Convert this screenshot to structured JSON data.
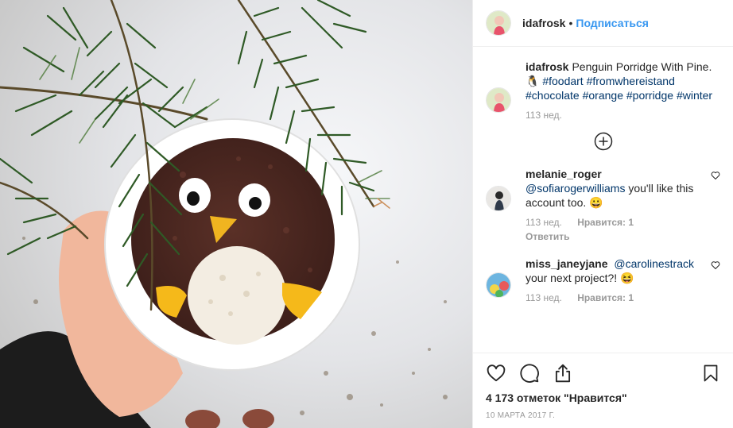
{
  "post": {
    "username": "idafrosk",
    "separator": "•",
    "follow_label": "Подписаться"
  },
  "caption": {
    "username": "idafrosk",
    "text": "Penguin Porridge With Pine. 🐧",
    "hashtags": [
      "#foodart",
      "#fromwhereistand",
      "#chocolate",
      "#orange",
      "#porridge",
      "#winter"
    ],
    "time": "113 нед."
  },
  "comments": [
    {
      "username": "melanie_roger",
      "mention": "@sofiarogerwilliams",
      "text": "you'll like this account too. 😀",
      "time": "113 нед.",
      "likes": "Нравится: 1",
      "reply": "Ответить"
    },
    {
      "username": "miss_janeyjane",
      "mention": "@carolinestrack",
      "text": "your next project?! 😆",
      "time": "113 нед.",
      "likes": "Нравится: 1"
    }
  ],
  "likes_text": "4 173 отметок \"Нравится\"",
  "date": "10 МАРТА 2017 Г.",
  "icons": {
    "like": "heart-icon",
    "comment": "comment-icon",
    "share": "share-icon",
    "save": "bookmark-icon",
    "load_more": "plus-circle-icon"
  },
  "colors": {
    "link": "#3897f0",
    "hashtag": "#003569",
    "muted": "#999999"
  }
}
